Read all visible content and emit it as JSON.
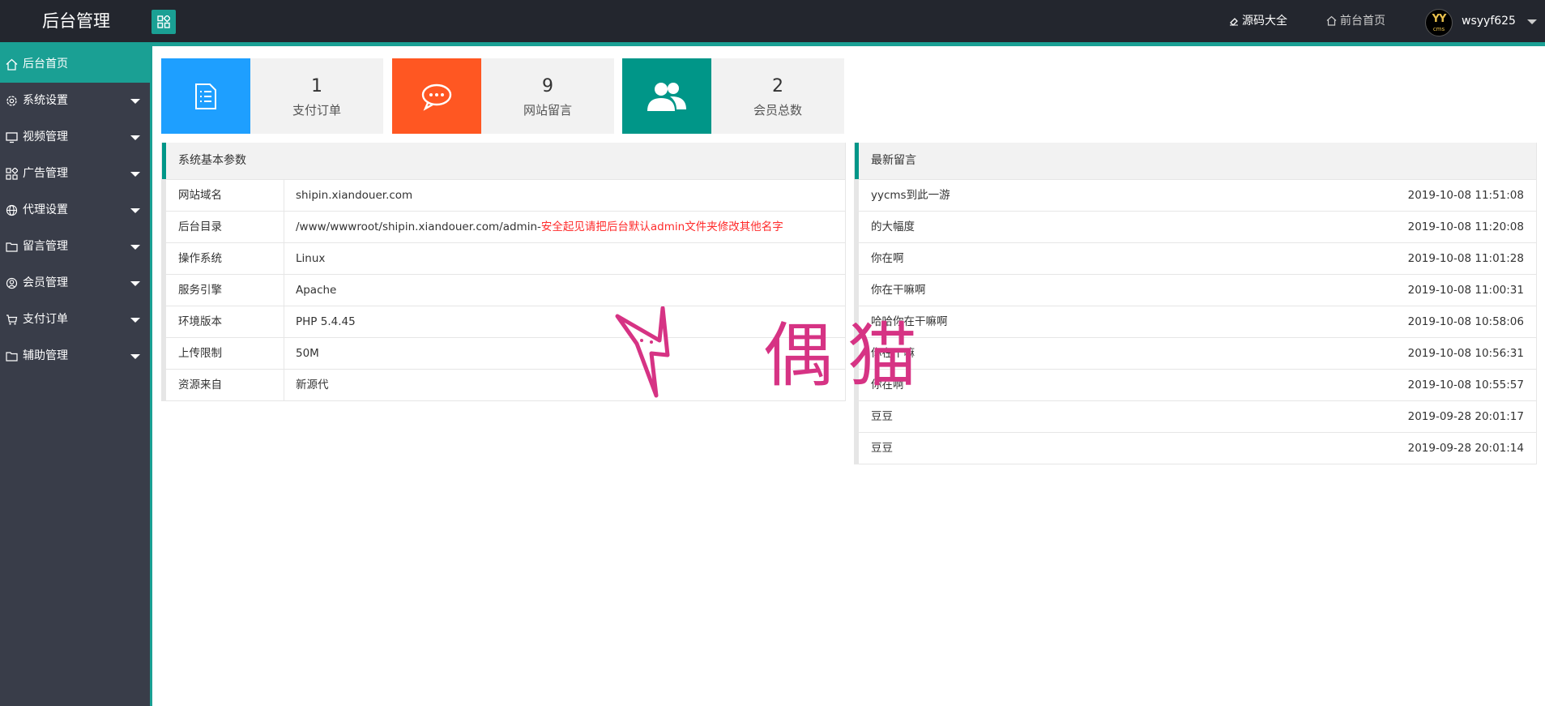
{
  "header": {
    "logo": "后台管理",
    "nav": {
      "yuanma": "源码大全",
      "front": "前台首页",
      "avatar_yy": "YY",
      "avatar_cms": "cms",
      "user": "wsyyf625"
    }
  },
  "sidebar": {
    "items": [
      {
        "label": "后台首页",
        "icon": "home-icon"
      },
      {
        "label": "系统设置",
        "icon": "gear-icon"
      },
      {
        "label": "视频管理",
        "icon": "monitor-icon"
      },
      {
        "label": "广告管理",
        "icon": "apps-icon"
      },
      {
        "label": "代理设置",
        "icon": "globe-icon"
      },
      {
        "label": "留言管理",
        "icon": "folder-icon"
      },
      {
        "label": "会员管理",
        "icon": "user-icon"
      },
      {
        "label": "支付订单",
        "icon": "cart-icon"
      },
      {
        "label": "辅助管理",
        "icon": "folder-icon"
      }
    ]
  },
  "stats": [
    {
      "value": "1",
      "label": "支付订单",
      "color": "#1e9fff",
      "icon": "document-icon"
    },
    {
      "value": "9",
      "label": "网站留言",
      "color": "#ff5722",
      "icon": "chat-icon"
    },
    {
      "value": "2",
      "label": "会员总数",
      "color": "#009688",
      "icon": "users-icon"
    }
  ],
  "system": {
    "title": "系统基本参数",
    "rows": [
      {
        "key": "网站域名",
        "value": "shipin.xiandouer.com",
        "warn": ""
      },
      {
        "key": "后台目录",
        "value": "/www/wwwroot/shipin.xiandouer.com/admin-",
        "warn": "安全起见请把后台默认admin文件夹修改其他名字"
      },
      {
        "key": "操作系统",
        "value": "Linux",
        "warn": ""
      },
      {
        "key": "服务引擎",
        "value": "Apache",
        "warn": ""
      },
      {
        "key": "环境版本",
        "value": "PHP 5.4.45",
        "warn": ""
      },
      {
        "key": "上传限制",
        "value": "50M",
        "warn": ""
      },
      {
        "key": "资源来自",
        "value": "新源代",
        "warn": ""
      }
    ]
  },
  "messages": {
    "title": "最新留言",
    "rows": [
      {
        "text": "yycms到此一游",
        "time": "2019-10-08 11:51:08"
      },
      {
        "text": "的大幅度",
        "time": "2019-10-08 11:20:08"
      },
      {
        "text": "你在啊",
        "time": "2019-10-08 11:01:28"
      },
      {
        "text": "你在干嘛啊",
        "time": "2019-10-08 11:00:31"
      },
      {
        "text": "哈哈你在干嘛啊",
        "time": "2019-10-08 10:58:06"
      },
      {
        "text": "你在干嘛",
        "time": "2019-10-08 10:56:31"
      },
      {
        "text": "你在啊",
        "time": "2019-10-08 10:55:57"
      },
      {
        "text": "豆豆",
        "time": "2019-09-28 20:01:17"
      },
      {
        "text": "豆豆",
        "time": "2019-09-28 20:01:14"
      }
    ]
  },
  "watermark": {
    "text": "偶猫"
  }
}
